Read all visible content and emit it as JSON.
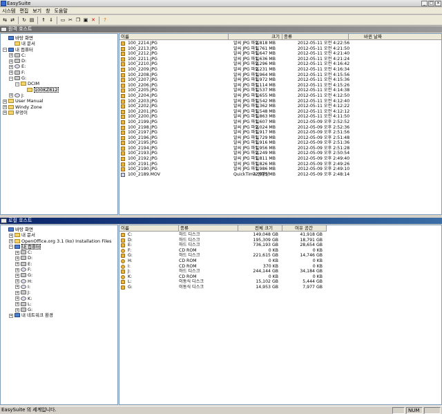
{
  "app": {
    "title": "EasySuite"
  },
  "menu": [
    "시스템",
    "편집",
    "보기",
    "창",
    "도움말"
  ],
  "toolbar_icons": [
    "connect-icon",
    "disconnect-icon",
    "refresh-icon",
    "view-icon",
    "upload-icon",
    "download-icon",
    "folder-icon",
    "cut-icon",
    "copy-icon",
    "paste-icon",
    "delete-icon",
    "help-icon"
  ],
  "remote": {
    "header": "원격 호스트",
    "tree": [
      {
        "label": "바탕 화면",
        "icon": "desktop",
        "lvl": 0,
        "pm": ""
      },
      {
        "label": "내 문서",
        "icon": "folder",
        "lvl": 1,
        "pm": ""
      },
      {
        "label": "내 컴퓨터",
        "icon": "computer",
        "lvl": 0,
        "pm": "-"
      },
      {
        "label": "C:",
        "icon": "drive",
        "lvl": 1,
        "pm": "+"
      },
      {
        "label": "D:",
        "icon": "drive",
        "lvl": 1,
        "pm": "+"
      },
      {
        "label": "E:",
        "icon": "cd",
        "lvl": 1,
        "pm": "+"
      },
      {
        "label": "F:",
        "icon": "drive",
        "lvl": 1,
        "pm": "+"
      },
      {
        "label": "G:",
        "icon": "drive",
        "lvl": 1,
        "pm": "-"
      },
      {
        "label": "DCIM",
        "icon": "folder",
        "lvl": 2,
        "pm": "-"
      },
      {
        "label": "100KZ812",
        "icon": "folder",
        "lvl": 3,
        "pm": "",
        "selected": true
      },
      {
        "label": "J:",
        "icon": "cd",
        "lvl": 1,
        "pm": "+"
      },
      {
        "label": "User Manual",
        "icon": "folder",
        "lvl": 0,
        "pm": "+"
      },
      {
        "label": "Windy Zone",
        "icon": "folder",
        "lvl": 0,
        "pm": "+"
      },
      {
        "label": "부엉이",
        "icon": "folder",
        "lvl": 0,
        "pm": "+"
      }
    ],
    "columns": [
      "이름",
      "크기",
      "종류",
      "바뀐 날짜"
    ],
    "files": [
      [
        "100_2214.JPG",
        "2,818 MB",
        "알씨 JPG 파일",
        "2012-05-11 오전 4:22:56"
      ],
      [
        "100_2213.JPG",
        "1,761 MB",
        "알씨 JPG 파일",
        "2012-05-11 오전 4:21:50"
      ],
      [
        "100_2212.JPG",
        "1,647 MB",
        "알씨 JPG 파일",
        "2012-05-11 오전 4:21:40"
      ],
      [
        "100_2211.JPG",
        "1,636 MB",
        "알씨 JPG 파일",
        "2012-05-11 오전 4:21:24"
      ],
      [
        "100_2210.JPG",
        "2,296 MB",
        "알씨 JPG 파일",
        "2012-05-11 오전 4:16:42"
      ],
      [
        "100_2209.JPG",
        "2,231 MB",
        "알씨 JPG 파일",
        "2012-05-11 오전 4:16:34"
      ],
      [
        "100_2208.JPG",
        "1,964 MB",
        "알씨 JPG 파일",
        "2012-05-11 오전 4:15:56"
      ],
      [
        "100_2207.JPG",
        "1,972 MB",
        "알씨 JPG 파일",
        "2012-05-11 오전 4:15:36"
      ],
      [
        "100_2206.JPG",
        "1,114 MB",
        "알씨 JPG 파일",
        "2012-05-11 오전 4:15:26"
      ],
      [
        "100_2205.JPG",
        "1,537 MB",
        "알씨 JPG 파일",
        "2012-05-11 오전 4:14:38"
      ],
      [
        "100_2204.JPG",
        "1,655 MB",
        "알씨 JPG 파일",
        "2012-05-11 오전 4:12:50"
      ],
      [
        "100_2203.JPG",
        "1,542 MB",
        "알씨 JPG 파일",
        "2012-05-11 오전 4:12:40"
      ],
      [
        "100_2202.JPG",
        "1,362 MB",
        "알씨 JPG 파일",
        "2012-05-11 오전 4:12:22"
      ],
      [
        "100_2201.JPG",
        "1,548 MB",
        "알씨 JPG 파일",
        "2012-05-11 오전 4:12:12"
      ],
      [
        "100_2200.JPG",
        "1,863 MB",
        "알씨 JPG 파일",
        "2012-05-11 오전 4:11:50"
      ],
      [
        "100_2199.JPG",
        "1,607 MB",
        "알씨 JPG 파일",
        "2012-05-09 오후 2:52:52"
      ],
      [
        "100_2198.JPG",
        "2,024 MB",
        "알씨 JPG 파일",
        "2012-05-09 오후 2:52:36"
      ],
      [
        "100_2197.JPG",
        "1,917 MB",
        "알씨 JPG 파일",
        "2012-05-09 오후 2:51:56"
      ],
      [
        "100_2196.JPG",
        "1,729 MB",
        "알씨 JPG 파일",
        "2012-05-09 오후 2:51:48"
      ],
      [
        "100_2195.JPG",
        "1,916 MB",
        "알씨 JPG 파일",
        "2012-05-09 오후 2:51:36"
      ],
      [
        "100_2194.JPG",
        "1,956 MB",
        "알씨 JPG 파일",
        "2012-05-09 오후 2:51:28"
      ],
      [
        "100_2193.JPG",
        "2,249 MB",
        "알씨 JPG 파일",
        "2012-05-09 오후 2:50:54"
      ],
      [
        "100_2192.JPG",
        "1,811 MB",
        "알씨 JPG 파일",
        "2012-05-09 오후 2:49:40"
      ],
      [
        "100_2191.JPG",
        "1,826 MB",
        "알씨 JPG 파일",
        "2012-05-09 오후 2:49:26"
      ],
      [
        "100_2190.JPG",
        "1,986 MB",
        "알씨 JPG 파일",
        "2012-05-09 오후 2:49:10"
      ],
      [
        "100_2189.MOV",
        "72,975 MB",
        "QuickTime 동영상",
        "2012-05-09 오후 2:48:14"
      ]
    ]
  },
  "local": {
    "header": "로컬 호스트",
    "tree": [
      {
        "label": "바탕 화면",
        "icon": "desktop",
        "lvl": 0,
        "pm": ""
      },
      {
        "label": "내 문서",
        "icon": "folder",
        "lvl": 1,
        "pm": "+"
      },
      {
        "label": "OpenOffice.org 3.1 (ko) Installation Files",
        "icon": "folder",
        "lvl": 1,
        "pm": "+"
      },
      {
        "label": "내 컴퓨터",
        "icon": "computer",
        "lvl": 1,
        "pm": "-",
        "selected": true
      },
      {
        "label": "C:",
        "icon": "drive",
        "lvl": 2,
        "pm": "+"
      },
      {
        "label": "D:",
        "icon": "drive",
        "lvl": 2,
        "pm": "+"
      },
      {
        "label": "E:",
        "icon": "drive",
        "lvl": 2,
        "pm": "+"
      },
      {
        "label": "F:",
        "icon": "cd",
        "lvl": 2,
        "pm": "+"
      },
      {
        "label": "G:",
        "icon": "drive",
        "lvl": 2,
        "pm": "+"
      },
      {
        "label": "H:",
        "icon": "cd",
        "lvl": 2,
        "pm": "+"
      },
      {
        "label": "I:",
        "icon": "cd",
        "lvl": 2,
        "pm": "+"
      },
      {
        "label": "J:",
        "icon": "drive",
        "lvl": 2,
        "pm": "+"
      },
      {
        "label": "K:",
        "icon": "cd",
        "lvl": 2,
        "pm": "+"
      },
      {
        "label": "L:",
        "icon": "drive",
        "lvl": 2,
        "pm": "+"
      },
      {
        "label": "G:",
        "icon": "drive",
        "lvl": 2,
        "pm": "+"
      },
      {
        "label": "내 네트워크 환경",
        "icon": "network",
        "lvl": 1,
        "pm": "+"
      }
    ],
    "columns": [
      "이름",
      "종류",
      "전체 크기",
      "여유 공간"
    ],
    "drives": [
      [
        "C:",
        "하드 디스크",
        "149,048 GB",
        "41,918 GB",
        "drive"
      ],
      [
        "D:",
        "하드 디스크",
        "195,309 GB",
        "18,791 GB",
        "drive"
      ],
      [
        "E:",
        "하드 디스크",
        "736,193 GB",
        "28,654 GB",
        "drive"
      ],
      [
        "F:",
        "CD ROM",
        "0 KB",
        "0 KB",
        "cd"
      ],
      [
        "G:",
        "하드 디스크",
        "221,615 GB",
        "14,746 GB",
        "drive"
      ],
      [
        "H:",
        "CD ROM",
        "0 KB",
        "0 KB",
        "cd"
      ],
      [
        "I:",
        "CD ROM",
        "370 KB",
        "0 KB",
        "cd"
      ],
      [
        "J:",
        "하드 디스크",
        "244,144 GB",
        "34,184 GB",
        "drive"
      ],
      [
        "K:",
        "CD ROM",
        "0 KB",
        "0 KB",
        "cd"
      ],
      [
        "L:",
        "이동식 디스크",
        "15,102 GB",
        "5,444 GB",
        "drive"
      ],
      [
        "G:",
        "이동식 디스크",
        "14,953 GB",
        "7,977 GB",
        "drive"
      ]
    ]
  },
  "status": {
    "message": "EasySuite 의 세계입니다.",
    "mode": "NUM"
  }
}
